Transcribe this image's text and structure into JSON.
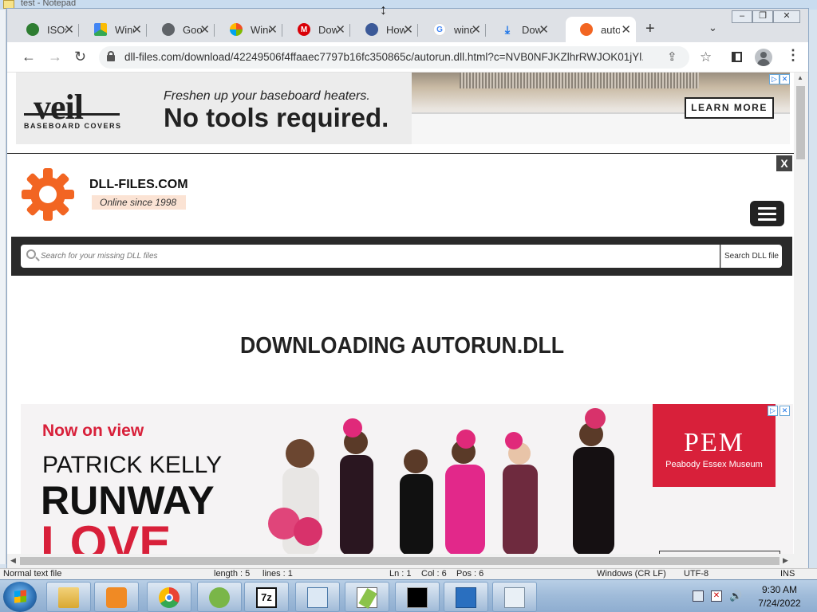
{
  "notepad": {
    "title": "test - Notepad",
    "status": {
      "mode": "Normal text file",
      "length": "length : 5",
      "lines": "lines : 1",
      "ln": "Ln : 1",
      "col": "Col : 6",
      "pos": "Pos : 6",
      "eol": "Windows (CR LF)",
      "encoding": "UTF-8",
      "ins": "INS"
    }
  },
  "browser": {
    "tabs": [
      {
        "label": "ISOs",
        "icon": "globe-icon",
        "color": "#2e7d32"
      },
      {
        "label": "Windows",
        "icon": "google-drive-icon",
        "color": "#fbbc04"
      },
      {
        "label": "Google",
        "icon": "globe-icon",
        "color": "#5f6368"
      },
      {
        "label": "Windows",
        "icon": "windows-icon",
        "color": "#1565c0"
      },
      {
        "label": "Download",
        "icon": "mega-icon",
        "color": "#d90007"
      },
      {
        "label": "How",
        "icon": "edge-icon",
        "color": "#3b5998"
      },
      {
        "label": "windows",
        "icon": "google-icon",
        "color": "#4285f4"
      },
      {
        "label": "Download",
        "icon": "download-icon",
        "color": "#1a73e8"
      },
      {
        "label": "autorun",
        "icon": "dll-gear-icon",
        "color": "#f26522",
        "active": true
      }
    ],
    "url": "dll-files.com/download/42249506f4ffaaec7797b16fc350865c/autorun.dll.html?c=NVB0NFJKZlhrRWJOK01jYl..."
  },
  "ad_top": {
    "brand": "veil",
    "brand_sub": "BASEBOARD COVERS",
    "line1": "Freshen up your baseboard heaters.",
    "line2": "No tools required.",
    "cta": "LEARN MORE"
  },
  "site": {
    "close_label": "X",
    "name": "DLL-FILES.COM",
    "tagline": "Online since 1998",
    "search_placeholder": "Search for your missing DLL files",
    "search_button": "Search DLL file",
    "heading": "DOWNLOADING AUTORUN.DLL"
  },
  "ad_bottom": {
    "kicker": "Now on view",
    "line1": "PATRICK KELLY",
    "line2": "RUNWAY",
    "line3": "LOVE",
    "museum_logo": "PEM",
    "museum_name": "Peabody Essex Museum"
  },
  "taskbar": {
    "apps": [
      "explorer",
      "media-player",
      "chrome",
      "app",
      "7zip",
      "control-panel",
      "notepad-plus-plus",
      "cmd",
      "windows-update",
      "document"
    ],
    "time": "9:30 AM",
    "date": "7/24/2022"
  },
  "colors": {
    "dll_orange": "#f26522",
    "pem_red": "#d8203a"
  }
}
